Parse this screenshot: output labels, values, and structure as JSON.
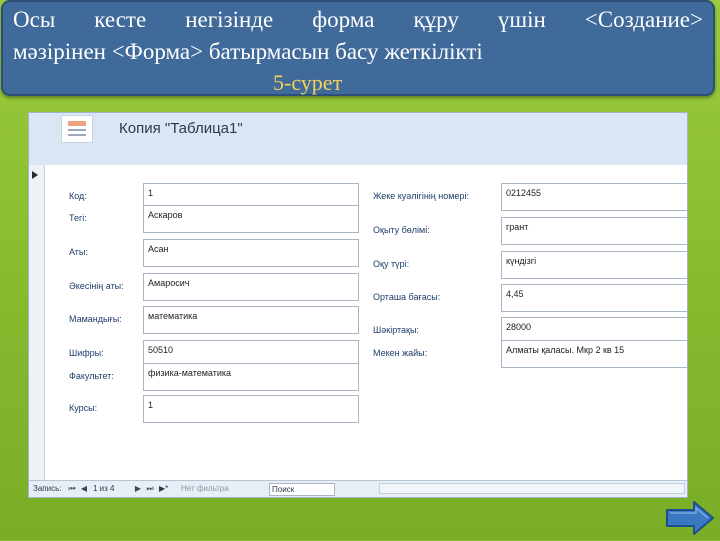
{
  "slide": {
    "title_line1": "Осы кесте негізінде форма құру үшін <Создание>",
    "title_line2": "мәзірінен <Форма> батырмасын басу жеткілікті",
    "caption": "5-сурет"
  },
  "access": {
    "form_title": "Копия \"Таблица1\"",
    "left_fields": [
      {
        "label": "Код:",
        "value": "1"
      },
      {
        "label": "Тегі:",
        "value": "Аскаров"
      },
      {
        "label": "Аты:",
        "value": "Асан"
      },
      {
        "label": "Әкесінің аты:",
        "value": "Амаросич"
      },
      {
        "label": "Мамандығы:",
        "value": "математика"
      },
      {
        "label": "Шифры:",
        "value": "50510"
      },
      {
        "label": "Факультет:",
        "value": "физика-математика"
      },
      {
        "label": "Курсы:",
        "value": "1"
      }
    ],
    "right_fields": [
      {
        "label": "Жеке куәлігінің номері:",
        "value": "0212455"
      },
      {
        "label": "Оқыту бөлімі:",
        "value": "грант"
      },
      {
        "label": "Оқу түрі:",
        "value": "күндізгі"
      },
      {
        "label": "Орташа бағасы:",
        "value": "4,45"
      },
      {
        "label": "Шәкіртақы:",
        "value": "28000"
      },
      {
        "label": "Мекен жайы:",
        "value": "Алматы қаласы. Мкр 2 кв 15"
      }
    ],
    "nav": {
      "record_label": "Запись:",
      "first": "⏮",
      "prev": "◀",
      "position": "1 из 4",
      "next": "▶",
      "last": "⏭",
      "new": "▶*",
      "filter_label": "Нет фильтра",
      "search_placeholder": "Поиск"
    }
  },
  "icons": {
    "form_icon": "form-icon",
    "next_slide": "right-arrow-icon"
  },
  "colors": {
    "slide_green": "#8cbc34",
    "title_blue": "#3f6a9a",
    "caption_yellow": "#f2d35a",
    "header_blue": "#dbe6f4",
    "label_blue": "#1f3e6a"
  }
}
